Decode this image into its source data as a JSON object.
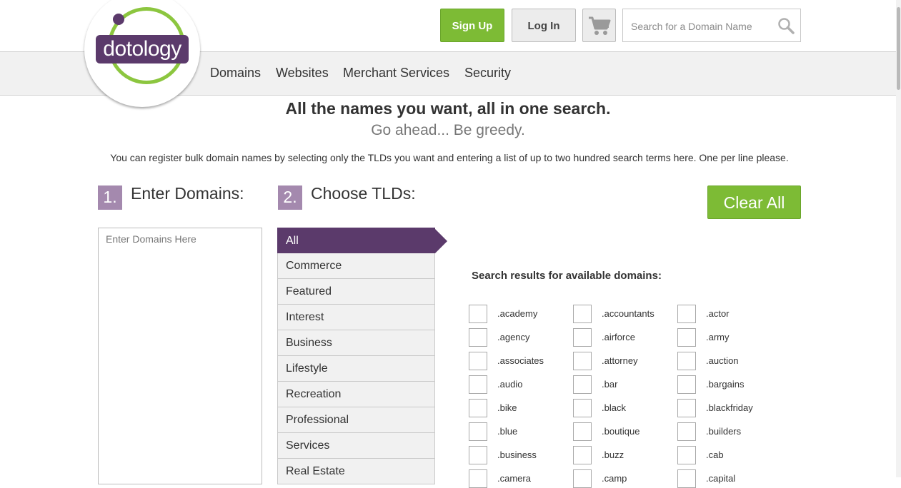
{
  "brand": {
    "logo_text": "dotology"
  },
  "header": {
    "signup_label": "Sign Up",
    "login_label": "Log In",
    "search_placeholder": "Search for a Domain Name"
  },
  "nav": [
    "Domains",
    "Websites",
    "Merchant Services",
    "Security"
  ],
  "intro": {
    "headline": "All the names you want, all in one search.",
    "subline": "Go ahead... Be greedy.",
    "description": "You can register bulk domain names by selecting only the TLDs you want and entering a list of up to two hundred search terms here. One per line please."
  },
  "steps": {
    "step1_num": "1.",
    "step1_label": "Enter Domains:",
    "step2_num": "2.",
    "step2_label": "Choose TLDs:",
    "clear_all_label": "Clear All",
    "domains_placeholder": "Enter Domains Here"
  },
  "categories": [
    {
      "label": "All",
      "active": true
    },
    {
      "label": "Commerce",
      "active": false
    },
    {
      "label": "Featured",
      "active": false
    },
    {
      "label": "Interest",
      "active": false
    },
    {
      "label": "Business",
      "active": false
    },
    {
      "label": "Lifestyle",
      "active": false
    },
    {
      "label": "Recreation",
      "active": false
    },
    {
      "label": "Professional",
      "active": false
    },
    {
      "label": "Services",
      "active": false
    },
    {
      "label": "Real Estate",
      "active": false
    }
  ],
  "results": {
    "title": "Search results for available domains:",
    "tlds": [
      ".academy",
      ".accountants",
      ".actor",
      ".agency",
      ".airforce",
      ".army",
      ".associates",
      ".attorney",
      ".auction",
      ".audio",
      ".bar",
      ".bargains",
      ".bike",
      ".black",
      ".blackfriday",
      ".blue",
      ".boutique",
      ".builders",
      ".business",
      ".buzz",
      ".cab",
      ".camera",
      ".camp",
      ".capital"
    ]
  },
  "colors": {
    "brand_purple": "#5b3a6b",
    "brand_green": "#7dbb35",
    "step_badge": "#a489ae"
  }
}
